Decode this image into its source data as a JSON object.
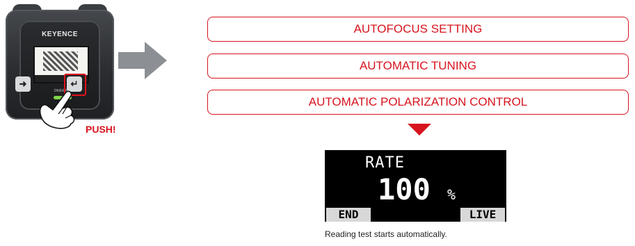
{
  "device": {
    "brand": "KEYENCE",
    "led_label": "OK/ERROR",
    "push_label": "PUSH!",
    "icons": [
      "arrow-right-icon",
      "enter-icon",
      "hand-pointer-icon"
    ]
  },
  "steps": [
    {
      "label": "AUTOFOCUS SETTING"
    },
    {
      "label": "AUTOMATIC TUNING"
    },
    {
      "label": "AUTOMATIC POLARIZATION CONTROL"
    }
  ],
  "display": {
    "title": "RATE",
    "value": "100",
    "unit": "%",
    "left_button": "END",
    "right_button": "LIVE"
  },
  "caption": "Reading test starts automatically.",
  "colors": {
    "accent": "#d7141e",
    "arrow": "#8c9094",
    "lcd_bg": "#000000"
  }
}
